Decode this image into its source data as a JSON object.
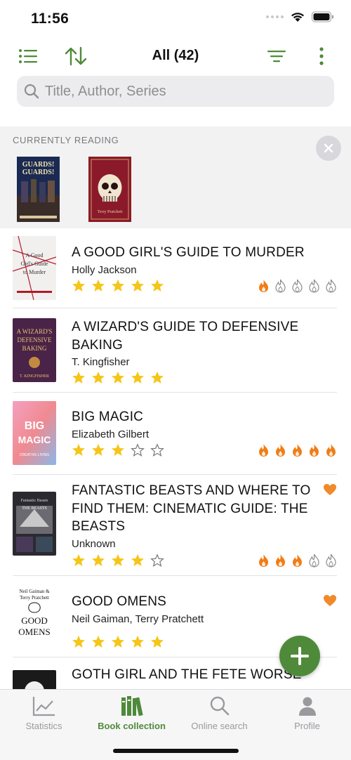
{
  "status": {
    "time": "11:56"
  },
  "toolbar": {
    "title": "All (42)"
  },
  "search": {
    "placeholder": "Title, Author, Series"
  },
  "reading": {
    "label": "CURRENTLY READING",
    "covers": [
      {
        "title": "GUARDS! GUARDS!"
      },
      {
        "title": "Terry Pratchett"
      }
    ]
  },
  "books": [
    {
      "title": "A GOOD GIRL'S GUIDE TO MURDER",
      "author": "Holly Jackson",
      "rating": 5,
      "heat": 1,
      "favorite": false,
      "cover_text": "A Good Girl's Guide to Murder"
    },
    {
      "title": "A WIZARD'S GUIDE TO DEFENSIVE BAKING",
      "author": "T. Kingfisher",
      "rating": 5,
      "heat": 0,
      "favorite": false,
      "cover_text": "A Wizard's Guide to Defensive Baking"
    },
    {
      "title": "BIG MAGIC",
      "author": "Elizabeth Gilbert",
      "rating": 3,
      "heat": 5,
      "favorite": false,
      "cover_text": "BIG MAGIC"
    },
    {
      "title": "FANTASTIC BEASTS AND WHERE TO FIND THEM: CINEMATIC GUIDE: THE BEASTS",
      "author": "Unknown",
      "rating": 4,
      "heat": 3,
      "favorite": true,
      "cover_text": "THE BEASTS"
    },
    {
      "title": "GOOD OMENS",
      "author": "Neil Gaiman, Terry Pratchett",
      "rating": 5,
      "heat": 0,
      "favorite": true,
      "cover_text": "GOOD OMENS"
    },
    {
      "title": "GOTH GIRL AND THE FETE WORSE",
      "author": "",
      "rating": 0,
      "heat": 0,
      "favorite": false,
      "cover_text": ""
    }
  ],
  "tabs": [
    {
      "label": "Statistics",
      "icon": "chart-icon",
      "active": false
    },
    {
      "label": "Book collection",
      "icon": "books-icon",
      "active": true
    },
    {
      "label": "Online search",
      "icon": "search-icon",
      "active": false
    },
    {
      "label": "Profile",
      "icon": "person-icon",
      "active": false
    }
  ],
  "colors": {
    "accent": "#4f8a3a",
    "star": "#f5c518",
    "flame": "#f07d17",
    "heart": "#f08a2a"
  }
}
